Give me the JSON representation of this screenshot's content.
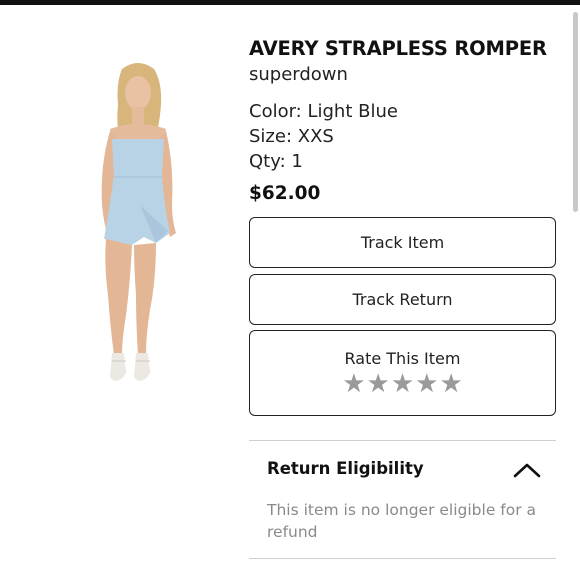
{
  "product": {
    "title": "AVERY STRAPLESS ROMPER",
    "brand": "superdown",
    "color_text": "Color: Light Blue",
    "size_text": "Size: XXS",
    "qty_text": "Qty: 1",
    "price": "$62.00",
    "image_icon": "product-photo"
  },
  "actions": {
    "track_item_label": "Track Item",
    "track_return_label": "Track Return",
    "rate_label": "Rate This Item",
    "stars": [
      "★",
      "★",
      "★",
      "★",
      "★"
    ],
    "rating": 0
  },
  "eligibility": {
    "title": "Return Eligibility",
    "text": "This item is no longer eligible for a refund",
    "expanded": true,
    "icon": "chevron-up-icon"
  },
  "colors": {
    "text": "#111111",
    "muted": "#8a8a8a",
    "star": "#9a9a9a",
    "border": "#222222",
    "romper": "#b9d3e6"
  }
}
